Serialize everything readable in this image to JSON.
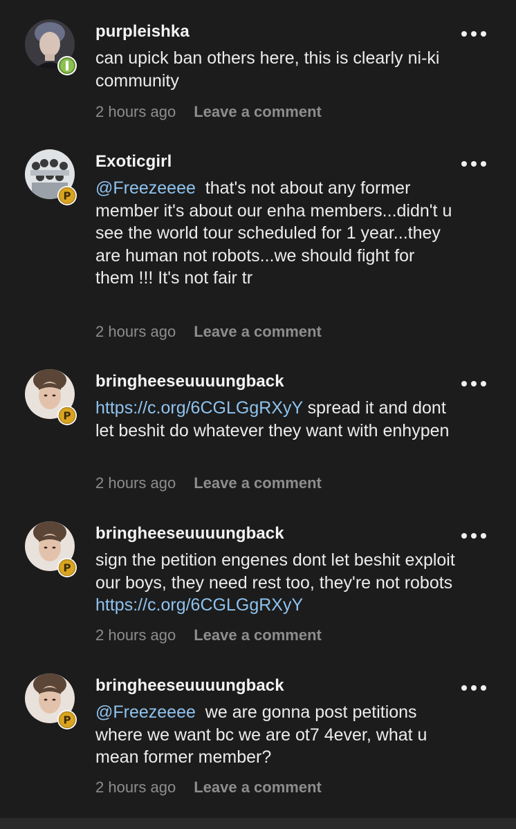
{
  "comments": [
    {
      "username": "purpleishka",
      "badge": "medal",
      "parts": [
        {
          "text": "can upick ban others here, this is clearly ni-ki community",
          "link": false
        }
      ],
      "time": "2 hours ago",
      "leave_label": "Leave a comment"
    },
    {
      "username": "Exoticgirl",
      "badge": "P",
      "parts": [
        {
          "text": "@Freezeeee",
          "link": true
        },
        {
          "text": "  that's not about any former member it's about our enha members...didn't u see the world tour scheduled for 1 year...they are human not robots...we should fight for them !!! It's not fair tr",
          "link": false
        }
      ],
      "time": "2 hours ago",
      "leave_label": "Leave a comment"
    },
    {
      "username": "bringheeseuuuungback",
      "badge": "P",
      "parts": [
        {
          "text": "https://c.org/6CGLGgRXyY",
          "link": true
        },
        {
          "text": " spread it and dont let beshit do whatever they want with enhypen",
          "link": false
        }
      ],
      "time": "2 hours ago",
      "leave_label": "Leave a comment"
    },
    {
      "username": "bringheeseuuuungback",
      "badge": "P",
      "parts": [
        {
          "text": "sign the petition engenes dont let beshit exploit our boys, they need rest too, they're not robots  ",
          "link": false
        },
        {
          "text": "https://c.org/6CGLGgRXyY",
          "link": true
        }
      ],
      "time": "2 hours ago",
      "leave_label": "Leave a comment"
    },
    {
      "username": "bringheeseuuuungback",
      "badge": "P",
      "parts": [
        {
          "text": "@Freezeeee",
          "link": true
        },
        {
          "text": "  we are gonna post petitions where we want bc we are ot7 4ever, what u mean former member?",
          "link": false
        }
      ],
      "time": "2 hours ago",
      "leave_label": "Leave a comment"
    }
  ],
  "colors": {
    "background": "#1c1c1c",
    "text": "#ececec",
    "link": "#8fc3ef",
    "meta": "#8d8d8d",
    "badge_gold": "#d9a521",
    "badge_green": "#7ab648"
  }
}
